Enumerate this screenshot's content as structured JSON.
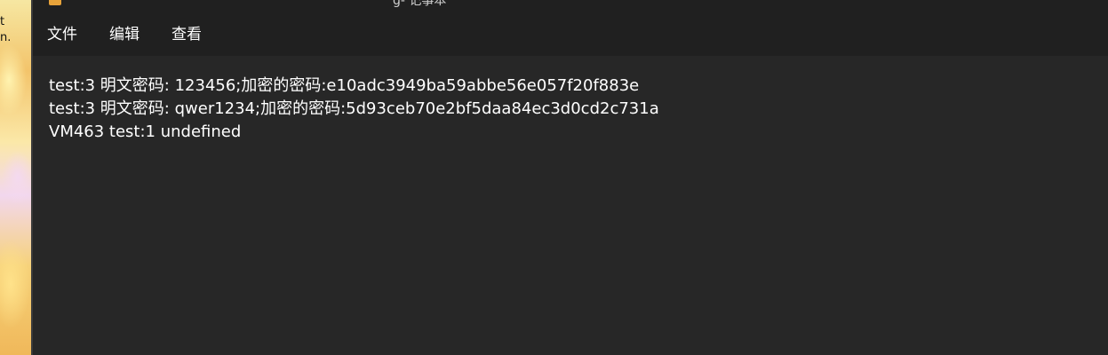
{
  "desktop": {
    "wallpaper_text": "t\nn."
  },
  "window": {
    "title_fragment": "g- 记事本"
  },
  "menu": {
    "file": "文件",
    "edit": "编辑",
    "view": "查看"
  },
  "editor": {
    "lines": [
      "test:3 明文密码: 123456;加密的密码:e10adc3949ba59abbe56e057f20f883e",
      "test:3 明文密码: qwer1234;加密的密码:5d93ceb70e2bf5daa84ec3d0cd2c731a",
      "VM463 test:1 undefined"
    ]
  },
  "colors": {
    "window_bg": "#272727",
    "menubar_bg": "#202020",
    "text": "#ffffff"
  }
}
